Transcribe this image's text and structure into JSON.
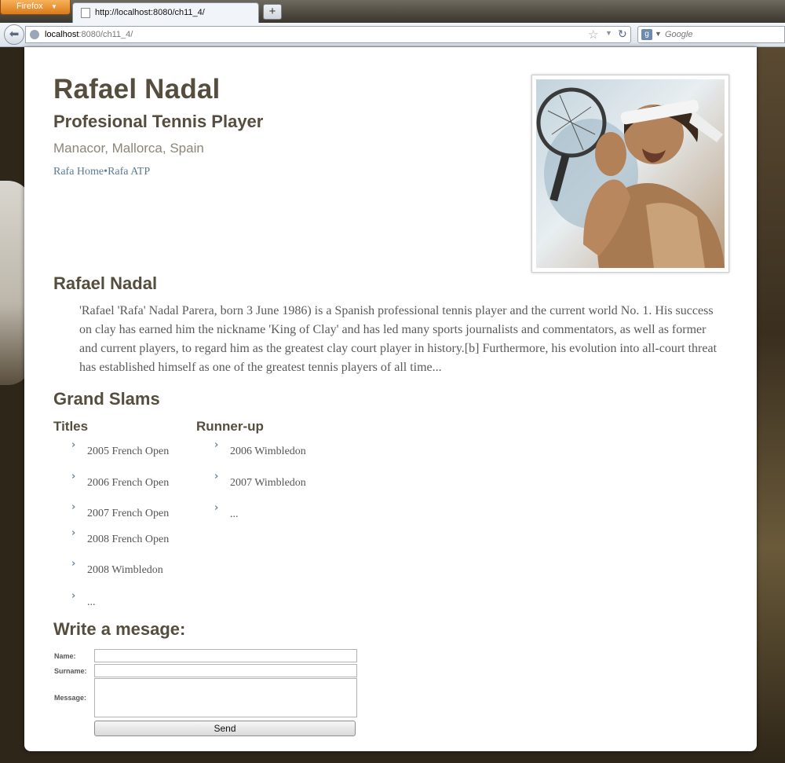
{
  "browser": {
    "menu_button": "Firefox",
    "tab_title": "http://localhost:8080/ch11_4/",
    "new_tab": "+",
    "url_host": "localhost",
    "url_path": ":8080/ch11_4/",
    "search_placeholder": "Google"
  },
  "profile": {
    "name": "Rafael Nadal",
    "role": "Profesional Tennis Player",
    "location": "Manacor, Mallorca, Spain",
    "links": [
      {
        "label": "Rafa Home"
      },
      {
        "label": "Rafa ATP"
      }
    ],
    "link_separator": "•"
  },
  "bio": {
    "heading": "Rafael Nadal",
    "text": "'Rafael 'Rafa' Nadal Parera, born 3 June 1986) is a Spanish professional tennis player and the current world No. 1. His success on clay has earned him the nickname 'King of Clay' and has led many sports journalists and commentators, as well as former and current players, to regard him as the greatest clay court player in history.[b] Furthermore, his evolution into all-court threat has established himself as one of the greatest tennis players of all time..."
  },
  "grand_slams": {
    "heading": "Grand Slams",
    "titles": {
      "label": "Titles",
      "items": [
        "2005 French Open",
        "2006 French Open",
        "2007 French Open",
        "2008 French Open",
        "2008 Wimbledon",
        "..."
      ]
    },
    "runner_up": {
      "label": "Runner-up",
      "items": [
        "2006 Wimbledon",
        "2007 Wimbledon",
        "..."
      ]
    }
  },
  "message_form": {
    "heading": "Write a mesage:",
    "name_label": "Name:",
    "surname_label": "Surname:",
    "message_label": "Message:",
    "send_label": "Send"
  },
  "colors": {
    "heading": "#554d3d",
    "link": "#5c7a98",
    "body_text": "#5a5a5a"
  }
}
